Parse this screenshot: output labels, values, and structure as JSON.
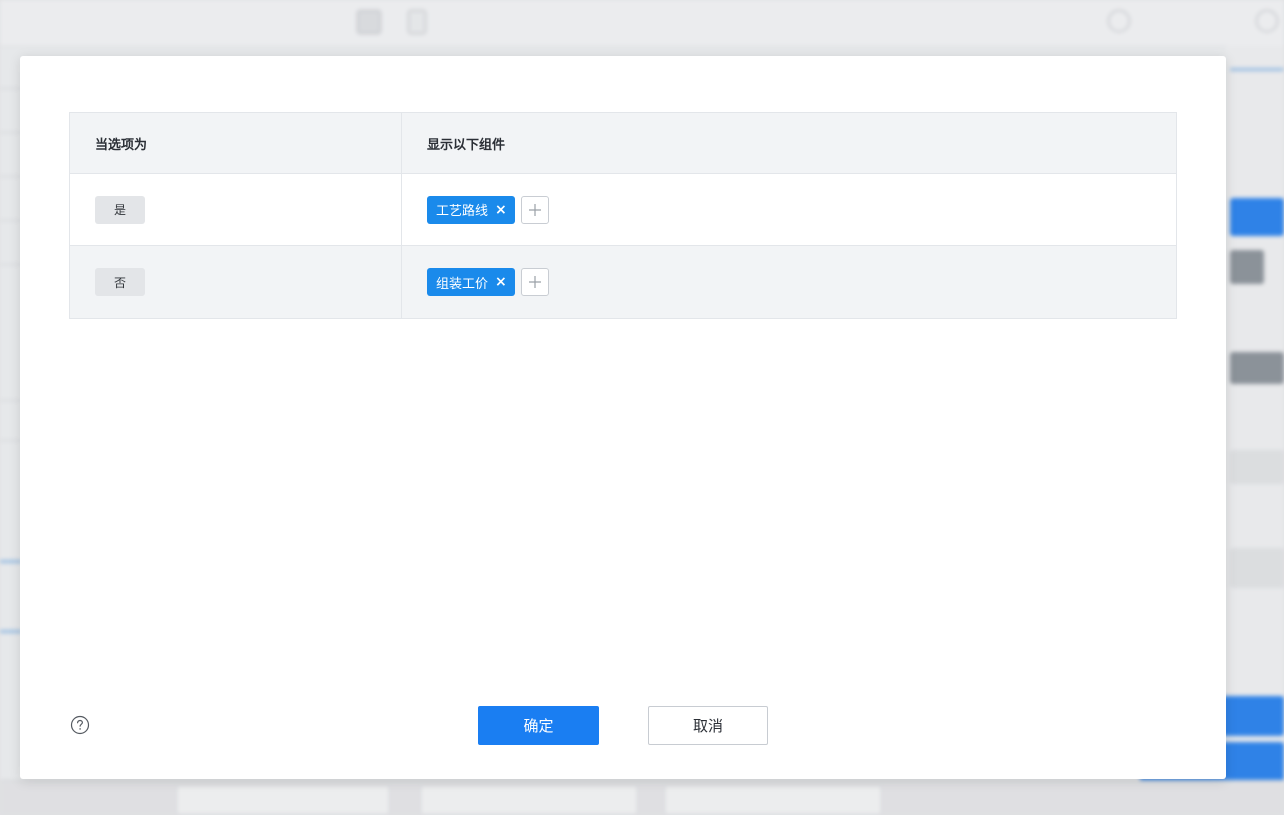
{
  "modal": {
    "table": {
      "headers": {
        "option": "当选项为",
        "components": "显示以下组件"
      },
      "rows": [
        {
          "option": "是",
          "components": [
            {
              "label": "工艺路线"
            }
          ]
        },
        {
          "option": "否",
          "components": [
            {
              "label": "组装工价"
            }
          ]
        }
      ]
    },
    "tag_remove_glyph": "×",
    "add_button_icon": "plus-icon",
    "help_icon": "question-circle-icon",
    "footer": {
      "confirm_label": "确定",
      "cancel_label": "取消"
    }
  },
  "colors": {
    "primary": "#1a7ef2",
    "tag": "#1a8aeb",
    "header_bg": "#f2f4f6",
    "border": "#e3e6ea"
  }
}
